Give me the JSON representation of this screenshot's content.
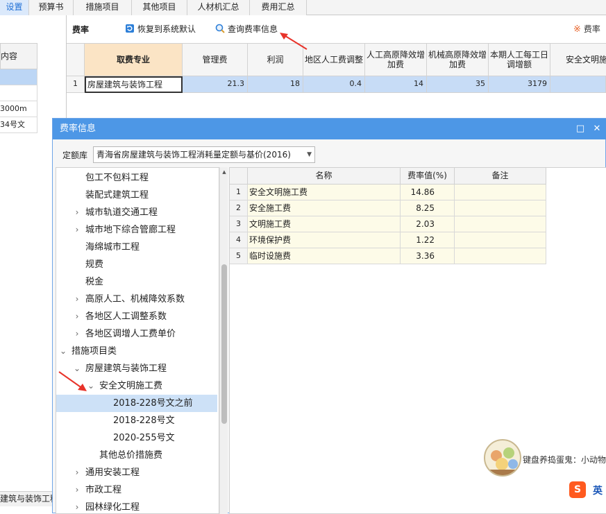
{
  "tabs": [
    "设置",
    "预算书",
    "措施项目",
    "其他项目",
    "人材机汇总",
    "费用汇总"
  ],
  "left_panel": {
    "header": "内容",
    "cells": [
      "",
      "",
      "3000m",
      "34号文"
    ],
    "bottom_tab": "建筑与装饰工程"
  },
  "fee_toolbar": {
    "title": "费率",
    "restore_label": "恢复到系统默认",
    "query_label": "查询费率信息",
    "right_label": "费率"
  },
  "fee_grid": {
    "headers": [
      "取费专业",
      "管理费",
      "利润",
      "地区人工费调整",
      "人工高原降效增加费",
      "机械高原降效增加费",
      "本期人工每工日调增额",
      "安全文明施"
    ],
    "row": {
      "num": "1",
      "profession": "房屋建筑与装饰工程",
      "values": [
        "21.3",
        "18",
        "0.4",
        "14",
        "35",
        "3179",
        ""
      ]
    }
  },
  "dialog": {
    "title": "费率信息",
    "maximize": "□",
    "close": "✕",
    "lib_label": "定额库",
    "lib_value": "青海省房屋建筑与装饰工程消耗量定额与基价(2016)",
    "tree": [
      {
        "label": "包工不包料工程",
        "arrow": ""
      },
      {
        "label": "装配式建筑工程",
        "arrow": ""
      },
      {
        "label": "城市轨道交通工程",
        "arrow": "›"
      },
      {
        "label": "城市地下综合管廊工程",
        "arrow": "›"
      },
      {
        "label": "海绵城市工程",
        "arrow": ""
      },
      {
        "label": "规费",
        "arrow": ""
      },
      {
        "label": "税金",
        "arrow": ""
      },
      {
        "label": "高原人工、机械降效系数",
        "arrow": "›"
      },
      {
        "label": "各地区人工调整系数",
        "arrow": "›"
      },
      {
        "label": "各地区调增人工费单价",
        "arrow": "›"
      },
      {
        "label": "措施项目类",
        "arrow": "⌄"
      },
      {
        "label": "房屋建筑与装饰工程",
        "arrow": "⌄"
      },
      {
        "label": "安全文明施工费",
        "arrow": "⌄"
      },
      {
        "label": "2018-228号文之前",
        "arrow": ""
      },
      {
        "label": "2018-228号文",
        "arrow": ""
      },
      {
        "label": "2020-255号文",
        "arrow": ""
      },
      {
        "label": "其他总价措施费",
        "arrow": ""
      },
      {
        "label": "通用安装工程",
        "arrow": "›"
      },
      {
        "label": "市政工程",
        "arrow": "›"
      },
      {
        "label": "园林绿化工程",
        "arrow": "›"
      }
    ],
    "table": {
      "headers": [
        "名称",
        "费率值(%)",
        "备注"
      ],
      "rows": [
        {
          "num": "1",
          "name": "安全文明施工费",
          "rate": "14.86",
          "note": ""
        },
        {
          "num": "2",
          "name": "安全施工费",
          "rate": "8.25",
          "note": ""
        },
        {
          "num": "3",
          "name": "文明施工费",
          "rate": "2.03",
          "note": ""
        },
        {
          "num": "4",
          "name": "环境保护费",
          "rate": "1.22",
          "note": ""
        },
        {
          "num": "5",
          "name": "临时设施费",
          "rate": "3.36",
          "note": ""
        }
      ]
    }
  },
  "tray": {
    "mascot_text": "键盘养捣蛋鬼：小动物",
    "ime_logo": "S",
    "ime_mode": "英"
  },
  "colors": {
    "accent": "#4d97e6",
    "arrow_red": "#e8332a",
    "selected_row": "#c7dcf6",
    "key_header": "#fbe4c5"
  }
}
